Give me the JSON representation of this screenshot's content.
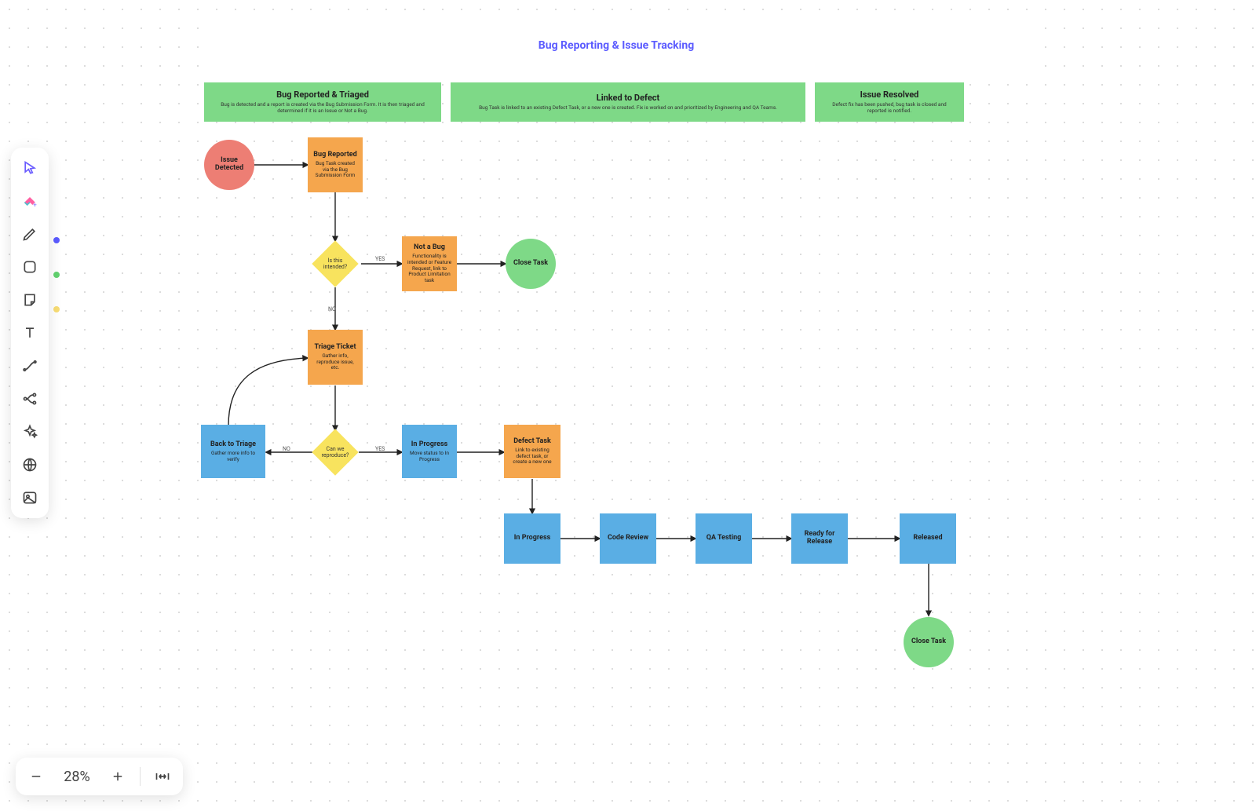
{
  "title": "Bug Reporting & Issue Tracking",
  "zoom": "28%",
  "lanes": {
    "reported": {
      "title": "Bug Reported & Triaged",
      "sub": "Bug is detected and a report is created via the Bug Submission Form. It is then triaged and determined if it is an Issue or Not a Bug."
    },
    "linked": {
      "title": "Linked to Defect",
      "sub": "Bug Task is linked to an existing Defect Task, or a new one is created. Fix is worked on and prioritized by Engineering and QA Teams."
    },
    "resolved": {
      "title": "Issue Resolved",
      "sub": "Defect fix has been pushed, bug task is closed and reported is notified."
    }
  },
  "nodes": {
    "issueDetected": {
      "title": "Issue Detected"
    },
    "bugReported": {
      "title": "Bug Reported",
      "sub": "Bug Task created via the Bug Submission Form"
    },
    "isIntended": {
      "title": "Is this\nintended?"
    },
    "notABug": {
      "title": "Not a Bug",
      "sub": "Functionality is intended or Feature Request, link to Product Limitation task"
    },
    "closeTask1": {
      "title": "Close Task"
    },
    "triageTicket": {
      "title": "Triage Ticket",
      "sub": "Gather info, reproduce issue, etc."
    },
    "canReproduce": {
      "title": "Can we\nreproduce?"
    },
    "backToTriage": {
      "title": "Back to Triage",
      "sub": "Gather more info to verify"
    },
    "inProgress1": {
      "title": "In Progress",
      "sub": "Move status to In Progress"
    },
    "defectTask": {
      "title": "Defect Task",
      "sub": "Link to existing defect task, or create a new one"
    },
    "inProgress2": {
      "title": "In Progress"
    },
    "codeReview": {
      "title": "Code Review"
    },
    "qaTesting": {
      "title": "QA Testing"
    },
    "readyRelease": {
      "title": "Ready for Release"
    },
    "released": {
      "title": "Released"
    },
    "closeTask2": {
      "title": "Close Task"
    }
  },
  "edgeLabels": {
    "yes": "YES",
    "no": "NO"
  },
  "tools": {
    "select": "select-tool",
    "clickup": "clickup-tool",
    "pen": "pen-tool",
    "shape": "shape-tool",
    "sticky": "sticky-note-tool",
    "text": "text-tool",
    "connector": "connector-tool",
    "mindmap": "mindmap-tool",
    "ai": "ai-tool",
    "web": "web-embed-tool",
    "image": "image-tool"
  }
}
